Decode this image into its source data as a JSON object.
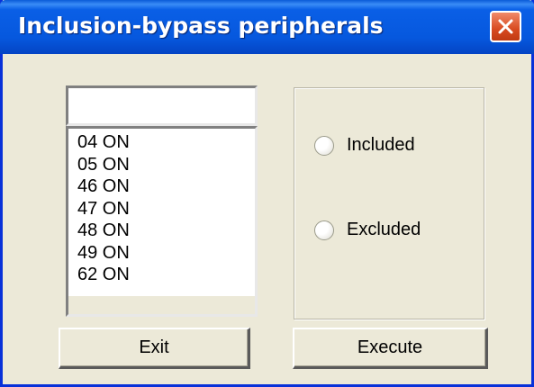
{
  "window": {
    "title": "Inclusion-bypass peripherals"
  },
  "filter_field": {
    "value": ""
  },
  "peripheral_list": {
    "items": [
      "04  ON",
      "05  ON",
      "46  ON",
      "47  ON",
      "48  ON",
      "49  ON",
      "62  ON"
    ]
  },
  "options": {
    "included_label": "Included",
    "excluded_label": "Excluded"
  },
  "buttons": {
    "exit_label": "Exit",
    "execute_label": "Execute"
  },
  "icons": {
    "close": "close-icon",
    "radio": "radio-icon"
  },
  "colors": {
    "titlebar": "#0658de",
    "close_button": "#d84a20",
    "window_face": "#ece9d8"
  }
}
